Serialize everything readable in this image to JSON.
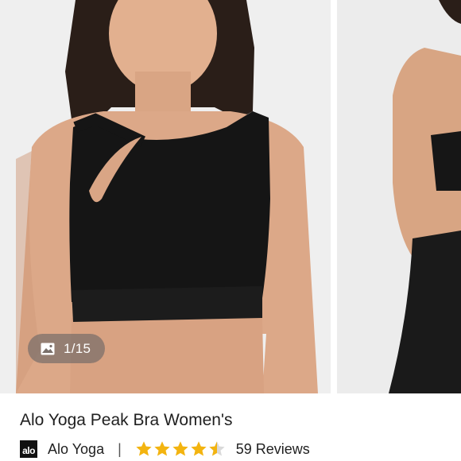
{
  "gallery": {
    "counter": "1/15",
    "main_image": "woman-wearing-black-asymmetric-cutout-sports-bra",
    "next_image": "back-view-black-sports-bra-and-leggings",
    "counter_icon": "image-icon"
  },
  "product": {
    "title": "Alo Yoga Peak Bra Women's",
    "brand_logo_text": "alo",
    "brand_name": "Alo Yoga",
    "separator": "|",
    "rating": 4.5,
    "rating_max": 5,
    "reviews": "59 Reviews"
  },
  "colors": {
    "star": "#f3b410",
    "star_empty": "#d9d9d9",
    "text": "#1f1f1f"
  }
}
